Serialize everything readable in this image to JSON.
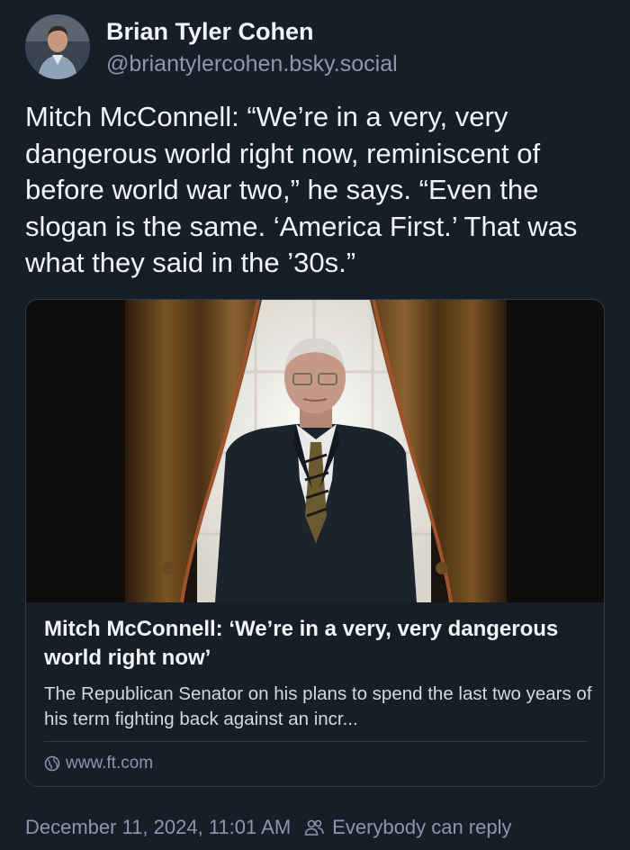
{
  "author": {
    "display_name": "Brian Tyler Cohen",
    "handle": "@briantylercohen.bsky.social",
    "avatar_icon": "avatar-photo"
  },
  "post": {
    "text": "Mitch McConnell: “We’re in a very, very dangerous world right now, reminiscent of before world war two,” he says. “Even the slogan is the same. ‘America First.’ That was what they said in the ’30s.”"
  },
  "embed": {
    "image_icon": "article-photo",
    "title": "Mitch McConnell: ‘We’re in a very, very dangerous world right now’",
    "description": "The Republican Senator on his plans to spend the last two years of his term fighting back against an incr...",
    "domain": "www.ft.com",
    "domain_icon": "globe-icon"
  },
  "meta": {
    "timestamp": "December 11, 2024, 11:01 AM",
    "reply_setting": "Everybody can reply",
    "reply_icon": "people-icon"
  },
  "colors": {
    "background": "#161e27",
    "text_primary": "#f1f3f5",
    "text_secondary": "#8b98a9",
    "border": "#2e3a48"
  }
}
